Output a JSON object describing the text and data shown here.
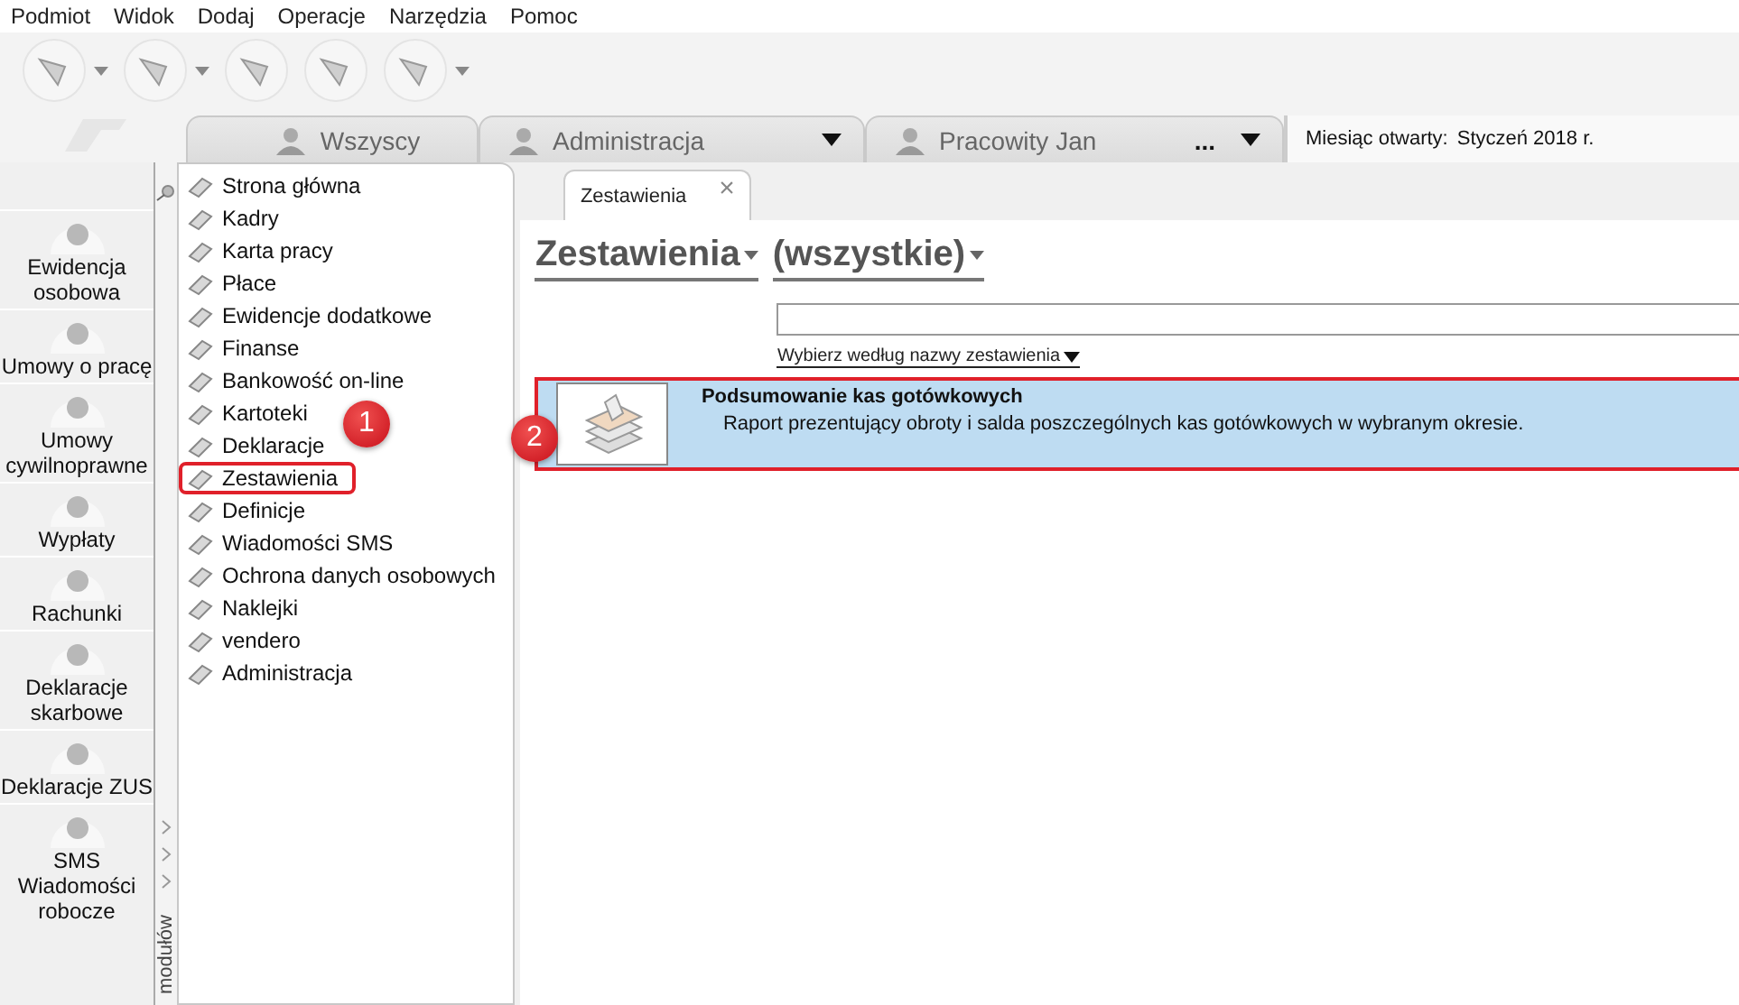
{
  "menu": [
    "Podmiot",
    "Widok",
    "Dodaj",
    "Operacje",
    "Narzędzia",
    "Pomoc"
  ],
  "toolbar": [
    {
      "has_menu": true
    },
    {
      "has_menu": true
    },
    {
      "has_menu": false
    },
    {
      "has_menu": false
    },
    {
      "has_menu": true
    }
  ],
  "tabs": [
    {
      "label": "Wszyscy",
      "dropdown": false
    },
    {
      "label": "Administracja",
      "dropdown": true
    },
    {
      "label": "Pracowity Jan",
      "more": "...",
      "dropdown": true
    }
  ],
  "status": {
    "label": "Miesiąc otwarty:",
    "value": "Styczeń 2018 r."
  },
  "modules": [
    "Ewidencja osobowa",
    "Umowy o pracę",
    "Umowy cywilnoprawne",
    "Wypłaty",
    "Rachunki",
    "Deklaracje skarbowe",
    "Deklaracje ZUS",
    "SMS Wiadomości robocze"
  ],
  "modules_label": "modułów",
  "nav": [
    {
      "label": "Strona główna",
      "highlighted": false
    },
    {
      "label": "Kadry",
      "highlighted": false
    },
    {
      "label": "Karta pracy",
      "highlighted": false
    },
    {
      "label": "Płace",
      "highlighted": false
    },
    {
      "label": "Ewidencje dodatkowe",
      "highlighted": false
    },
    {
      "label": "Finanse",
      "highlighted": false
    },
    {
      "label": "Bankowość on-line",
      "highlighted": false
    },
    {
      "label": "Kartoteki",
      "highlighted": false
    },
    {
      "label": "Deklaracje",
      "highlighted": false
    },
    {
      "label": "Zestawienia",
      "highlighted": true
    },
    {
      "label": "Definicje",
      "highlighted": false
    },
    {
      "label": "Wiadomości SMS",
      "highlighted": false
    },
    {
      "label": "Ochrona danych osobowych",
      "highlighted": false
    },
    {
      "label": "Naklejki",
      "highlighted": false
    },
    {
      "label": "vendero",
      "highlighted": false
    },
    {
      "label": "Administracja",
      "highlighted": false
    }
  ],
  "doc_tab": {
    "label": "Zestawienia",
    "close": "×"
  },
  "filters": [
    "Zestawienia",
    "(wszystkie)"
  ],
  "search": {
    "hint_link": "Wybierz według nazwy zestawienia"
  },
  "results": [
    {
      "title": "Podsumowanie kas gotówkowych",
      "description": "Raport prezentujący obroty i salda poszczególnych kas gotówkowych w wybranym okresie.",
      "selected": true,
      "highlighted": true
    }
  ],
  "callouts": [
    "1",
    "2"
  ]
}
